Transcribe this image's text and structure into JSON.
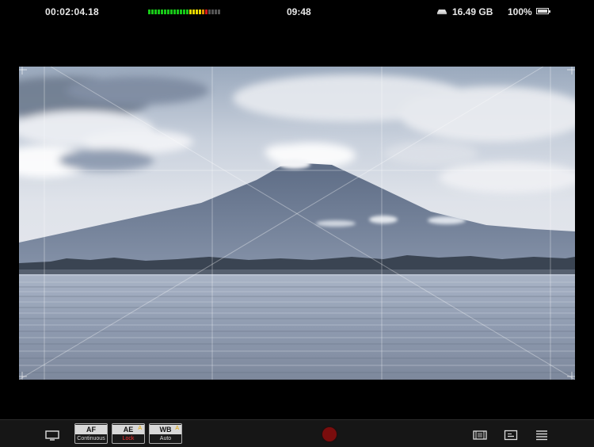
{
  "status_bar": {
    "timecode": "00:02:04.18",
    "clock": "09:48",
    "storage": "16.49 GB",
    "battery": "100%",
    "battery_level": 1.0,
    "audio_meter": {
      "segments": [
        "#18c818",
        "#18c818",
        "#18c818",
        "#18c818",
        "#18c818",
        "#18c818",
        "#18c818",
        "#18c818",
        "#18c818",
        "#18c818",
        "#18c818",
        "#18c818",
        "#18c818",
        "#e8d800",
        "#e8d800",
        "#e8d800",
        "#e8d800",
        "#e09000",
        "#d81818",
        "#555555",
        "#555555",
        "#555555",
        "#555555"
      ]
    }
  },
  "toolbar": {
    "af": {
      "label": "AF",
      "mode": "Continuous",
      "warning": "A"
    },
    "ae": {
      "label": "AE",
      "mode": "Lock",
      "warning": "A",
      "mode_color": "#ff3030"
    },
    "wb": {
      "label": "WB",
      "mode": "Auto",
      "warning": "A"
    }
  },
  "colors": {
    "record": "#7a0d0d",
    "toolbar_bg": "#161616"
  }
}
